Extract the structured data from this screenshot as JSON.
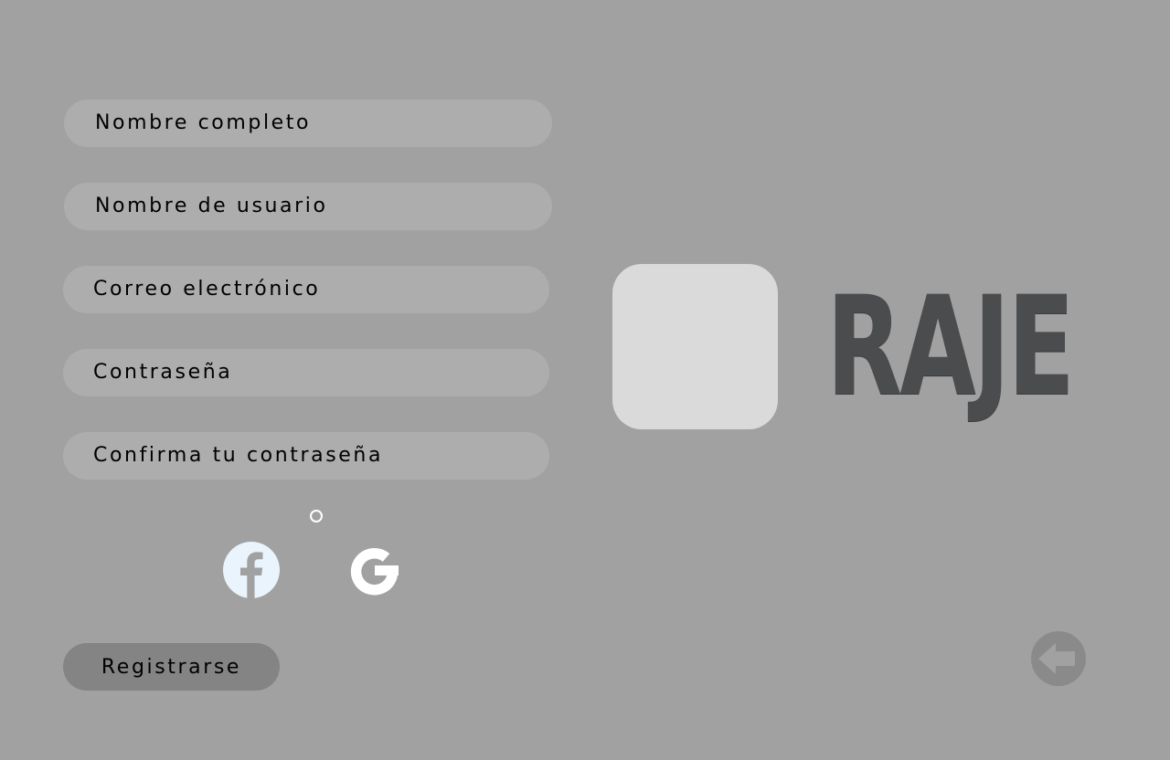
{
  "form": {
    "full_name_placeholder": "Nombre completo",
    "username_placeholder": "Nombre de usuario",
    "email_placeholder": "Correo electrónico",
    "password_placeholder": "Contraseña",
    "confirm_password_placeholder": "Confirma tu contraseña",
    "register_label": "Registrarse"
  },
  "social": {
    "facebook_icon": "facebook-icon",
    "google_icon": "google-icon"
  },
  "brand": {
    "name": "RAJE"
  },
  "navigation": {
    "back_icon": "arrow-left-circle-icon"
  },
  "colors": {
    "background": "#a1a1a1",
    "field": "#adadad",
    "button": "#848484",
    "brand_text": "#4b4c4e",
    "logo_box": "#dadada",
    "icon_light": "#eaf4fc"
  }
}
